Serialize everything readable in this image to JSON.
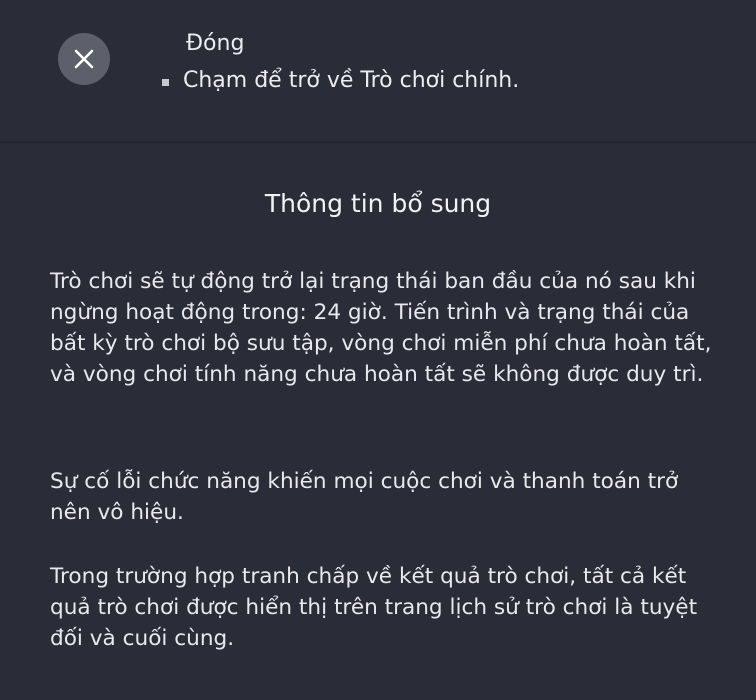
{
  "close": {
    "icon": "close-icon",
    "title": "Đóng",
    "description": "Chạm để trở về Trò chơi chính."
  },
  "info": {
    "title": "Thông tin bổ sung",
    "paragraphs": [
      "Trò chơi sẽ tự động trở lại trạng thái ban đầu của nó sau khi ngừng hoạt động trong: 24 giờ. Tiến trình và trạng thái của bất kỳ trò chơi bộ sưu tập, vòng chơi miễn phí chưa hoàn tất, và vòng chơi tính năng chưa hoàn tất sẽ không được duy trì.",
      "Sự cố lỗi chức năng khiến mọi cuộc chơi và thanh toán trở nên vô hiệu.",
      "Trong trường hợp tranh chấp về kết quả trò chơi, tất cả kết quả trò chơi được hiển thị trên trang lịch sử trò chơi là tuyệt đối và cuối cùng."
    ]
  },
  "colors": {
    "background": "#2a2c38",
    "button": "#5d5f6b",
    "text": "#ececf1"
  }
}
